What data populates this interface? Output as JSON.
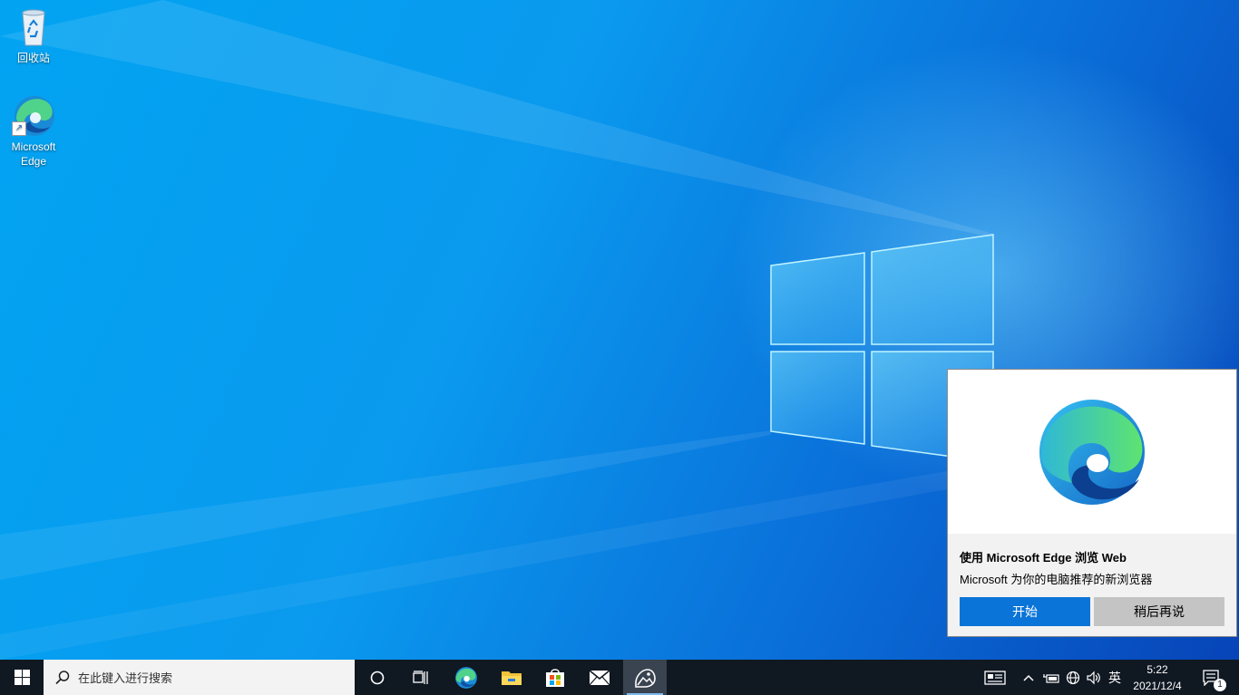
{
  "desktop": {
    "icons": [
      {
        "label": "回收站",
        "icon": "recycle-bin-icon"
      },
      {
        "label": "Microsoft Edge",
        "icon": "edge-icon"
      }
    ]
  },
  "toast": {
    "title": "使用 Microsoft Edge 浏览 Web",
    "subtitle": "Microsoft 为你的电脑推荐的新浏览器",
    "primary_button": "开始",
    "secondary_button": "稍后再说",
    "icon": "edge-logo-icon"
  },
  "taskbar": {
    "search_placeholder": "在此键入进行搜索",
    "pinned": [
      "start-icon",
      "search-icon",
      "cortana-icon",
      "task-view-icon",
      "edge-icon",
      "file-explorer-icon",
      "store-icon",
      "mail-icon",
      "photos-icon"
    ],
    "tray": {
      "ime": "英",
      "time": "5:22",
      "date": "2021/12/4",
      "notification_count": "1"
    }
  },
  "colors": {
    "accent": "#0a74d8",
    "taskbar": "#101822",
    "toast_bg": "#f2f2f2"
  }
}
